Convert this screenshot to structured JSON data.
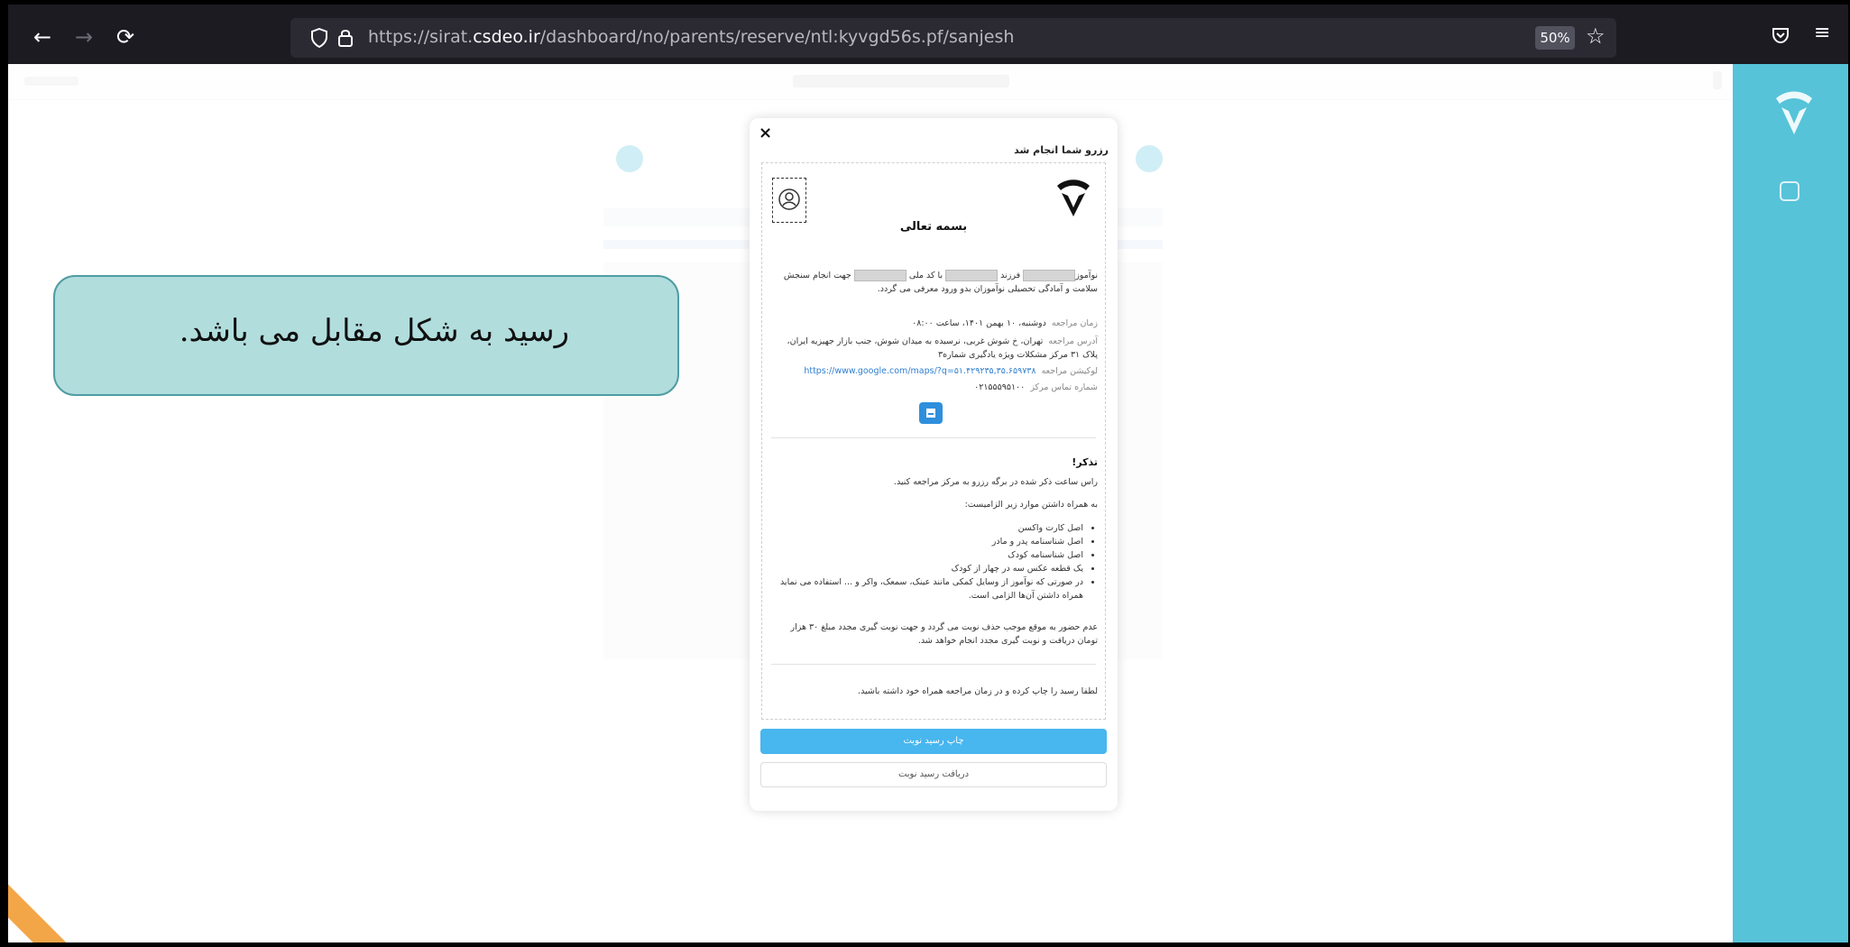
{
  "browser": {
    "url_prefix": "https://sirat.",
    "url_domain": "csdeo.ir",
    "url_path": "/dashboard/no/parents/reserve/ntl:kyvgd56s.pf/sanjesh",
    "zoom": "50%"
  },
  "modal": {
    "close": "×",
    "title": "رزرو شما انجام شد",
    "bismillah": "بسمه تعالی",
    "intro_1": "نوآموز",
    "intro_2": "فرزند",
    "intro_3": "با کد ملی",
    "intro_4": "جهت انجام سنجش سلامت و آمادگی تحصیلی نوآموزان بدو ورود معرفی می گردد.",
    "rows": [
      {
        "label": "زمان مراجعه",
        "value": "دوشنبه، ۱۰ بهمن ۱۴۰۱، ساعت ۰۸:۰۰"
      },
      {
        "label": "آدرس مراجعه",
        "value": "تهران، خ شوش غربی، نرسیده به میدان شوش، جنب بازار جهیزیه ایران، پلاک ۳۱ مرکز مشکلات ویژه یادگیری شماره۳"
      },
      {
        "label": "لوکیشن مراجعه",
        "value": "https://www.google.com/maps/?q=۵۱.۴۲۹۲۳۵,۳۵.۶۵۹۷۳۸"
      },
      {
        "label": "شماره تماس مرکز",
        "value": "۰۲۱۵۵۵۹۵۱۰۰"
      }
    ],
    "reminder_title": "تذکر!",
    "reminder_1": "راس ساعت ذکر شده در برگه رزرو به مرکز مراجعه کنید.",
    "reminder_2": "به همراه داشتن موارد زیر الزامیست:",
    "items": [
      "اصل کارت واکسن",
      "اصل شناسنامه پدر و مادر",
      "اصل شناسنامه کودک",
      "یک قطعه عکس سه در چهار از کودک",
      "در صورتی که نوآموز از وسایل کمکی مانند عینک، سمعک، واکر و ... استفاده می نماید همراه داشتن آن‌ها الزامی است."
    ],
    "absence": "عدم حضور به موقع موجب حذف نوبت می گردد و جهت نوبت گیری مجدد مبلغ ۳۰ هزار تومان دریافت و نوبت گیری مجدد انجام خواهد شد.",
    "footer": "لطفا رسید را چاپ کرده و در زمان مراجعه همراه خود داشته باشید.",
    "print_button": "چاپ رسید نوبت",
    "download_button": "دریافت رسید نوبت"
  },
  "callout": {
    "text": "رسید به شکل مقابل می باشد."
  }
}
